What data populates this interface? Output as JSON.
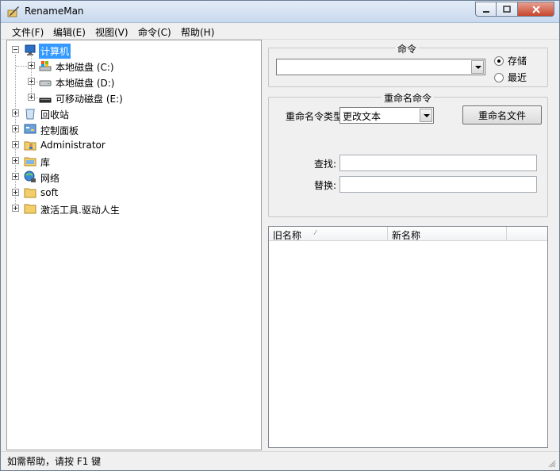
{
  "window": {
    "title": "RenameMan"
  },
  "menu": [
    "文件(F)",
    "编辑(E)",
    "视图(V)",
    "命令(C)",
    "帮助(H)"
  ],
  "tree": {
    "computer": "计算机",
    "drive_c": "本地磁盘 (C:)",
    "drive_d": "本地磁盘 (D:)",
    "drive_e": "可移动磁盘 (E:)",
    "recycle": "回收站",
    "control_panel": "控制面板",
    "admin": "Administrator",
    "library": "库",
    "network": "网络",
    "soft": "soft",
    "activation": "激活工具.驱动人生"
  },
  "command_group": {
    "title": "命令",
    "combo_value": "",
    "radio_save": "存储",
    "radio_recent": "最近"
  },
  "rename_group": {
    "title": "重命名命令",
    "type_label": "重命名令类型:",
    "type_value": "更改文本",
    "rename_button": "重命名文件",
    "find_label": "查找:",
    "find_value": "",
    "replace_label": "替换:",
    "replace_value": ""
  },
  "list": {
    "col_old": "旧名称",
    "col_new": "新名称"
  },
  "status": "如需帮助，请按 F1 键"
}
